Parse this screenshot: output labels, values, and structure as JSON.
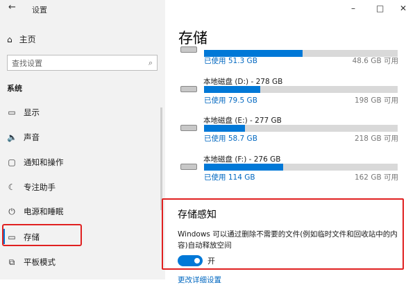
{
  "window": {
    "title": "设置",
    "back_glyph": "←",
    "minimize": "–",
    "maximize": "□",
    "close": "✕"
  },
  "sidebar": {
    "home": "主页",
    "search_placeholder": "查找设置",
    "section": "系统",
    "items": [
      {
        "label": "显示",
        "icon": "display-icon"
      },
      {
        "label": "声音",
        "icon": "sound-icon"
      },
      {
        "label": "通知和操作",
        "icon": "notification-icon"
      },
      {
        "label": "专注助手",
        "icon": "moon-icon"
      },
      {
        "label": "电源和睡眠",
        "icon": "power-icon"
      },
      {
        "label": "存储",
        "icon": "storage-icon",
        "active": true
      },
      {
        "label": "平板模式",
        "icon": "tablet-icon"
      }
    ]
  },
  "main": {
    "title": "存储",
    "drives": [
      {
        "name": "",
        "used": "已使用 51.3 GB",
        "free": "48.6 GB 可用",
        "fill": 0.51
      },
      {
        "name": "本地磁盘 (D:) - 278 GB",
        "used": "已使用 79.5 GB",
        "free": "198 GB 可用",
        "fill": 0.29
      },
      {
        "name": "本地磁盘 (E:) - 277 GB",
        "used": "已使用 58.7 GB",
        "free": "218 GB 可用",
        "fill": 0.21
      },
      {
        "name": "本地磁盘 (F:) - 276 GB",
        "used": "已使用 114 GB",
        "free": "162 GB 可用",
        "fill": 0.41
      }
    ],
    "storage_sense": {
      "title": "存储感知",
      "description": "Windows 可以通过删除不需要的文件(例如临时文件和回收站中的内容)自动释放空间",
      "toggle_label": "开",
      "toggle_on": true
    },
    "bottom_link": "更改详细设置"
  }
}
